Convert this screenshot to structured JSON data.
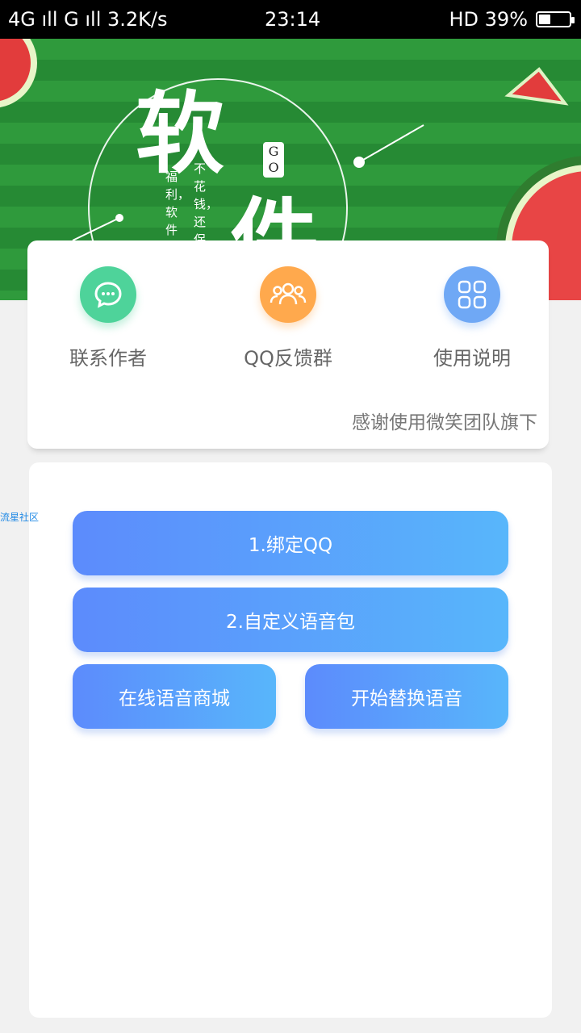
{
  "status_bar": {
    "left": "4G ıll G ıll 3.2K/s",
    "time": "23:14",
    "right": "HD 39%",
    "battery_percent": 39
  },
  "banner": {
    "title_1": "软",
    "title_2": "件",
    "go_label": "G O",
    "vertical_text_1": "福利，软件",
    "vertical_text_2": "不花钱，还保"
  },
  "functions": [
    {
      "label": "联系作者",
      "icon": "chat-bubble-icon",
      "color": "#4ed39a"
    },
    {
      "label": "QQ反馈群",
      "icon": "group-users-icon",
      "color": "#ffa94d"
    },
    {
      "label": "使用说明",
      "icon": "grid-apps-icon",
      "color": "#6fa8f5"
    }
  ],
  "thanks_text": "感谢使用微笑团队旗下",
  "side_link": "流星社区",
  "buttons": {
    "bind_qq": "1.绑定QQ",
    "custom_voice": "2.自定义语音包",
    "online_store": "在线语音商城",
    "start_replace": "开始替换语音"
  },
  "colors": {
    "button_start": "#5c8bfc",
    "button_end": "#58b6fb",
    "banner_green": "#2f9a3c"
  }
}
